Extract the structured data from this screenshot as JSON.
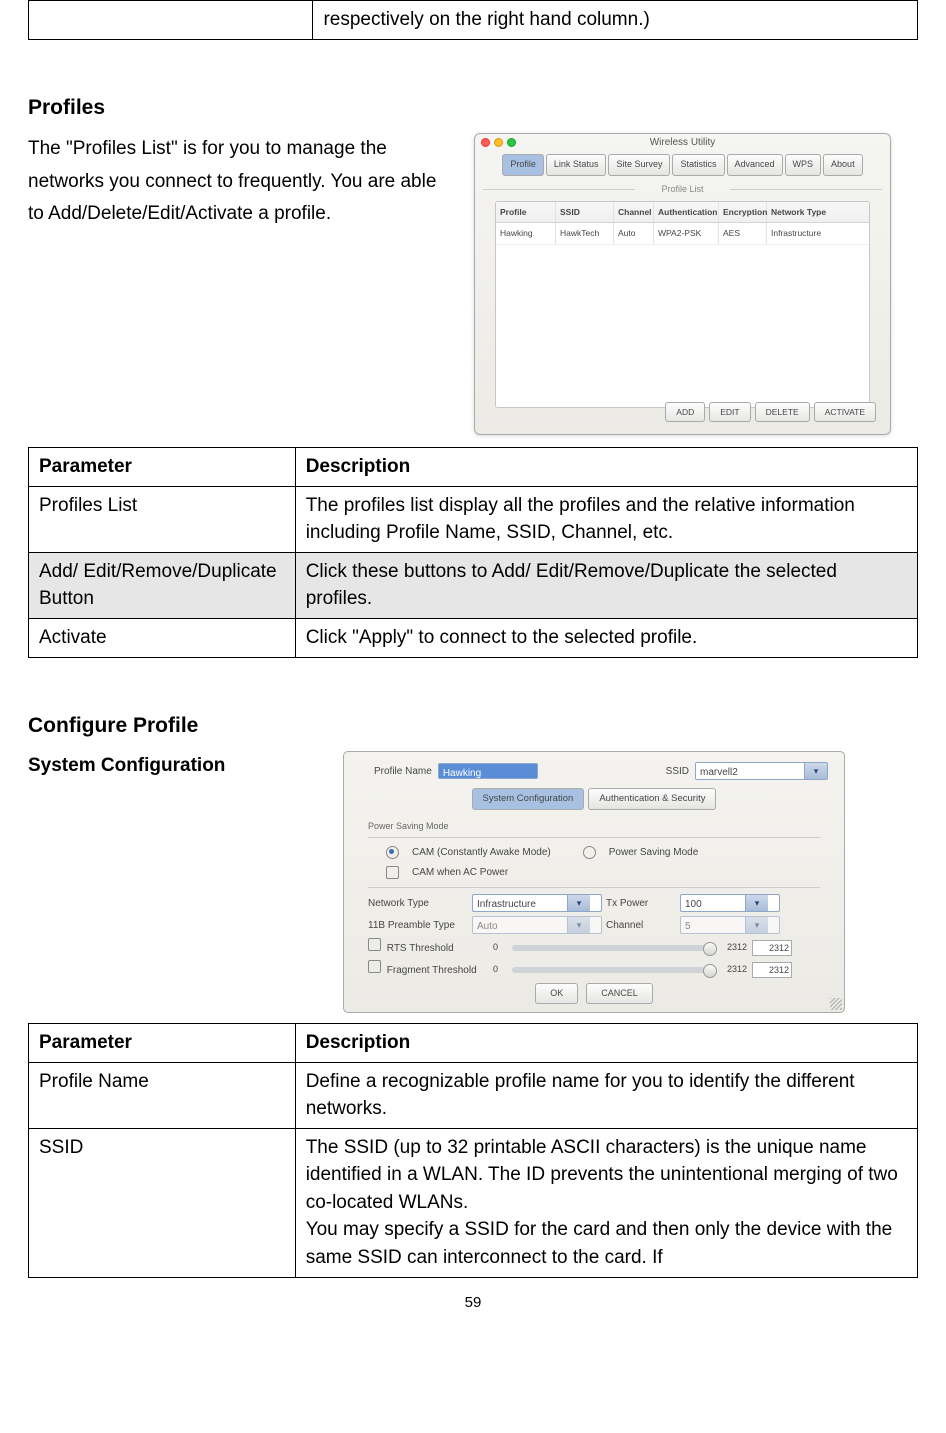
{
  "top_table_cell": "respectively on the right hand column.)",
  "profiles": {
    "heading": "Profiles",
    "intro": "The \"Profiles List\" is for you to manage the networks you connect to frequently. You are able to Add/Delete/Edit/Activate a profile."
  },
  "screenshot1": {
    "window_title": "Wireless Utility",
    "tabs": [
      "Profile",
      "Link Status",
      "Site Survey",
      "Statistics",
      "Advanced",
      "WPS",
      "About"
    ],
    "active_tab": 0,
    "section_title": "Profile List",
    "columns": [
      "Profile",
      "SSID",
      "Channel",
      "Authentication",
      "Encryption",
      "Network Type"
    ],
    "row": {
      "profile": "Hawking",
      "ssid": "HawkTech",
      "channel": "Auto",
      "auth": "WPA2-PSK",
      "encryption": "AES",
      "network": "Infrastructure"
    },
    "buttons": [
      "ADD",
      "EDIT",
      "DELETE",
      "ACTIVATE"
    ]
  },
  "table1": {
    "header": [
      "Parameter",
      "Description"
    ],
    "rows": [
      {
        "param": "Profiles List",
        "desc": "The profiles list display all the profiles and the relative information including Profile Name, SSID, Channel, etc."
      },
      {
        "param": "Add/ Edit/Remove/Duplicate Button",
        "desc": "Click these buttons to Add/ Edit/Remove/Duplicate the selected profiles.",
        "shaded": true
      },
      {
        "param": "Activate",
        "desc": "Click \"Apply\" to connect to the selected profile."
      }
    ]
  },
  "configure": {
    "heading": "Configure Profile",
    "sub": "System Configuration"
  },
  "screenshot2": {
    "profile_name_label": "Profile Name",
    "profile_name_value": "Hawking",
    "ssid_label": "SSID",
    "ssid_value": "marvell2",
    "tabs": [
      "System Configuration",
      "Authentication & Security"
    ],
    "psm": {
      "legend": "Power Saving Mode",
      "opt1": "CAM (Constantly Awake Mode)",
      "opt2": "Power Saving Mode",
      "check": "CAM when AC Power"
    },
    "network_type_label": "Network Type",
    "network_type_value": "Infrastructure",
    "tx_power_label": "Tx Power",
    "tx_power_value": "100",
    "preamble_label": "11B Preamble Type",
    "preamble_value": "Auto",
    "channel_label": "Channel",
    "channel_value": "5",
    "rts": {
      "label": "RTS Threshold",
      "min": "0",
      "max": "2312",
      "value": "2312"
    },
    "frag": {
      "label": "Fragment Threshold",
      "min": "0",
      "max": "2312",
      "value": "2312"
    },
    "btn_ok": "OK",
    "btn_cancel": "CANCEL"
  },
  "table2": {
    "header": [
      "Parameter",
      "Description"
    ],
    "rows": [
      {
        "param": "Profile Name",
        "desc": "Define a recognizable profile name for you to identify the different networks."
      },
      {
        "param": "SSID",
        "desc": "The SSID (up to 32 printable ASCII characters) is the unique name identified in a WLAN. The ID prevents the unintentional merging of two co-located WLANs.\nYou may specify a SSID for the card and then only the device with the same SSID can interconnect to the card. If"
      }
    ]
  },
  "page_number": "59"
}
